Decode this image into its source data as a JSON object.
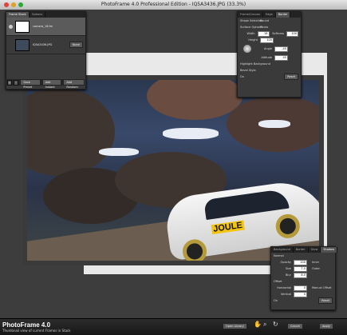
{
  "window": {
    "title": "PhotoFrame 4.0 Professional Edition - IQ5A3436.JPG (33.3%)"
  },
  "frame_stack": {
    "tabs": [
      "Frame Stack",
      "Options"
    ],
    "items": [
      {
        "name": "camera_18.fm",
        "extra": ""
      },
      {
        "name": "IQ5A3436.JPG",
        "extra": "None"
      }
    ],
    "footer": {
      "add": "+",
      "remove": "–",
      "save_preset": "Save Preset",
      "add_instant": "Add Instant",
      "add_random": "Add Random"
    }
  },
  "frame_panel": {
    "tabs": [
      "Frame/Canvas",
      "Edge",
      "Border"
    ],
    "shape_selection_label": "Shape Selection",
    "shape_selection_value": "Round",
    "surface_options_label": "Surface Options",
    "surface_options_value": "Photo",
    "width_label": "Width",
    "width_value": "18",
    "softness_label": "Softness",
    "softness_value": "100",
    "height_label": "Height",
    "height_value": "100",
    "angle_label": "Angle",
    "angle_value": "-45",
    "altitude_label": "Altitude",
    "altitude_value": "45",
    "highlight_label": "Highlight Background",
    "bevel_label": "Bevel Style",
    "on_label": "On",
    "reset_label": "Reset"
  },
  "shadow_panel": {
    "tabs": [
      "Background",
      "Border",
      "Glow",
      "Shadow"
    ],
    "normal_label": "Normal",
    "opacity_label": "Opacity",
    "opacity_value": "100",
    "size_label": "Size",
    "size_value": "7.0",
    "blur_label": "Blur",
    "blur_value": "8.0",
    "inner_label": "Inner",
    "outer_label": "Outer",
    "offset_label": "Offset",
    "horizontal_label": "Horizontal",
    "horizontal_value": "0",
    "vertical_label": "Vertical",
    "vertical_value": "0",
    "manual_offset_label": "Manual Offset",
    "on_label": "On",
    "reset_label": "Reset"
  },
  "photo": {
    "car_logo": "JOULE"
  },
  "bottom_bar": {
    "logo": "PhotoFrame 4.0",
    "status": "Thumbnail view of current Frames in Stack",
    "open_library": "Open Library",
    "cancel": "Cancel",
    "apply": "Apply",
    "tools": [
      "hand-tool",
      "zoom-tool",
      "rotate-tool"
    ]
  }
}
